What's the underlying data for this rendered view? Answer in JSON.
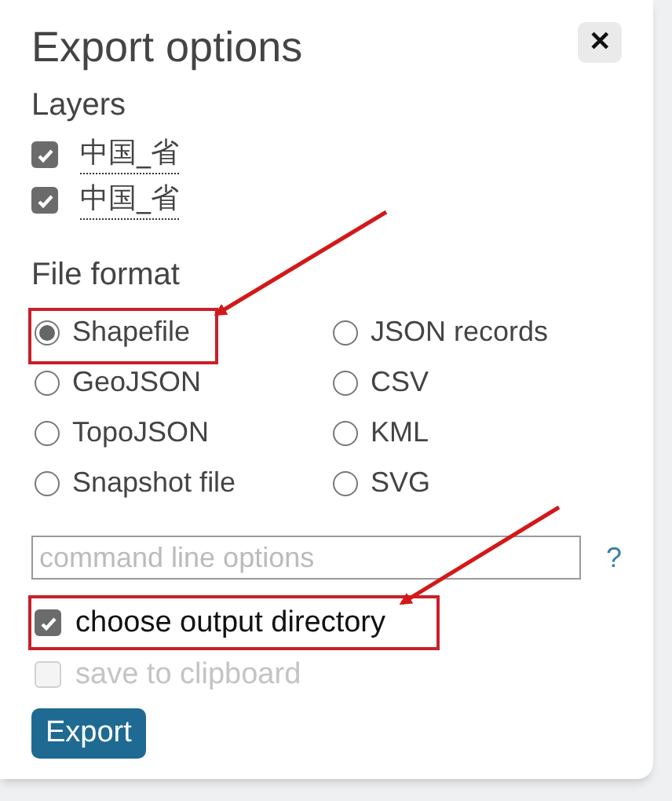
{
  "dialog": {
    "title": "Export options",
    "close": "✕"
  },
  "layers": {
    "heading": "Layers",
    "items": [
      {
        "label": "中国_省",
        "checked": true
      },
      {
        "label": "中国_省",
        "checked": true
      }
    ]
  },
  "file_format": {
    "heading": "File format",
    "options": [
      {
        "label": "Shapefile",
        "selected": true
      },
      {
        "label": "JSON records",
        "selected": false
      },
      {
        "label": "GeoJSON",
        "selected": false
      },
      {
        "label": "CSV",
        "selected": false
      },
      {
        "label": "TopoJSON",
        "selected": false
      },
      {
        "label": "KML",
        "selected": false
      },
      {
        "label": "Snapshot file",
        "selected": false
      },
      {
        "label": "SVG",
        "selected": false
      }
    ]
  },
  "command_line": {
    "placeholder": "command line options",
    "help": "?"
  },
  "options": [
    {
      "label": "choose output directory",
      "checked": true,
      "disabled": false
    },
    {
      "label": "save to clipboard",
      "checked": false,
      "disabled": true
    }
  ],
  "export_button": "Export"
}
